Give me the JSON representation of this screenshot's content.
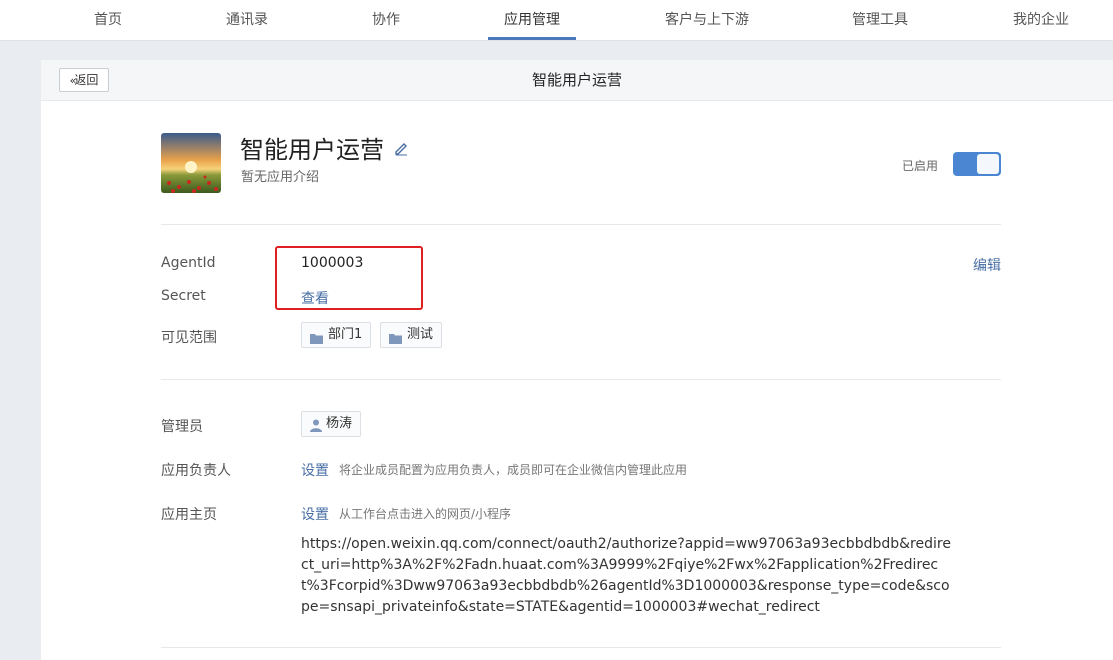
{
  "nav": {
    "items": [
      "首页",
      "通讯录",
      "协作",
      "应用管理",
      "客户与上下游",
      "管理工具",
      "我的企业"
    ],
    "active_index": 3,
    "accent_color": "#4a78b8"
  },
  "header": {
    "back_label": "返回",
    "title": "智能用户运营"
  },
  "app": {
    "name": "智能用户运营",
    "description": "暂无应用介绍",
    "status_label": "已启用",
    "enabled": true,
    "toggle_color": "#4a86d2"
  },
  "credentials": {
    "agentid_label": "AgentId",
    "agentid_value": "1000003",
    "edit_label": "编辑",
    "secret_label": "Secret",
    "secret_action": "查看"
  },
  "visibility": {
    "label": "可见范围",
    "tags": [
      "部门1",
      "测试"
    ]
  },
  "admin": {
    "label": "管理员",
    "user": "杨涛"
  },
  "owner": {
    "label": "应用负责人",
    "action": "设置",
    "hint": "将企业成员配置为应用负责人，成员即可在企业微信内管理此应用"
  },
  "homepage": {
    "label": "应用主页",
    "action": "设置",
    "hint": "从工作台点击进入的网页/小程序",
    "url": "https://open.weixin.qq.com/connect/oauth2/authorize?appid=ww97063a93ecbbdbdb&redirect_uri=http%3A%2F%2Fadn.huaat.com%3A9999%2Fqiye%2Fwx%2Fapplication%2Fredirect%3Fcorpid%3Dww97063a93ecbbdbdb%26agentId%3D1000003&response_type=code&scope=snsapi_privateinfo&state=STATE&agentid=1000003#wechat_redirect"
  },
  "icons": {
    "back": "double-chevron-left-icon",
    "edit": "pencil-icon",
    "folder": "folder-icon",
    "user": "user-icon"
  }
}
